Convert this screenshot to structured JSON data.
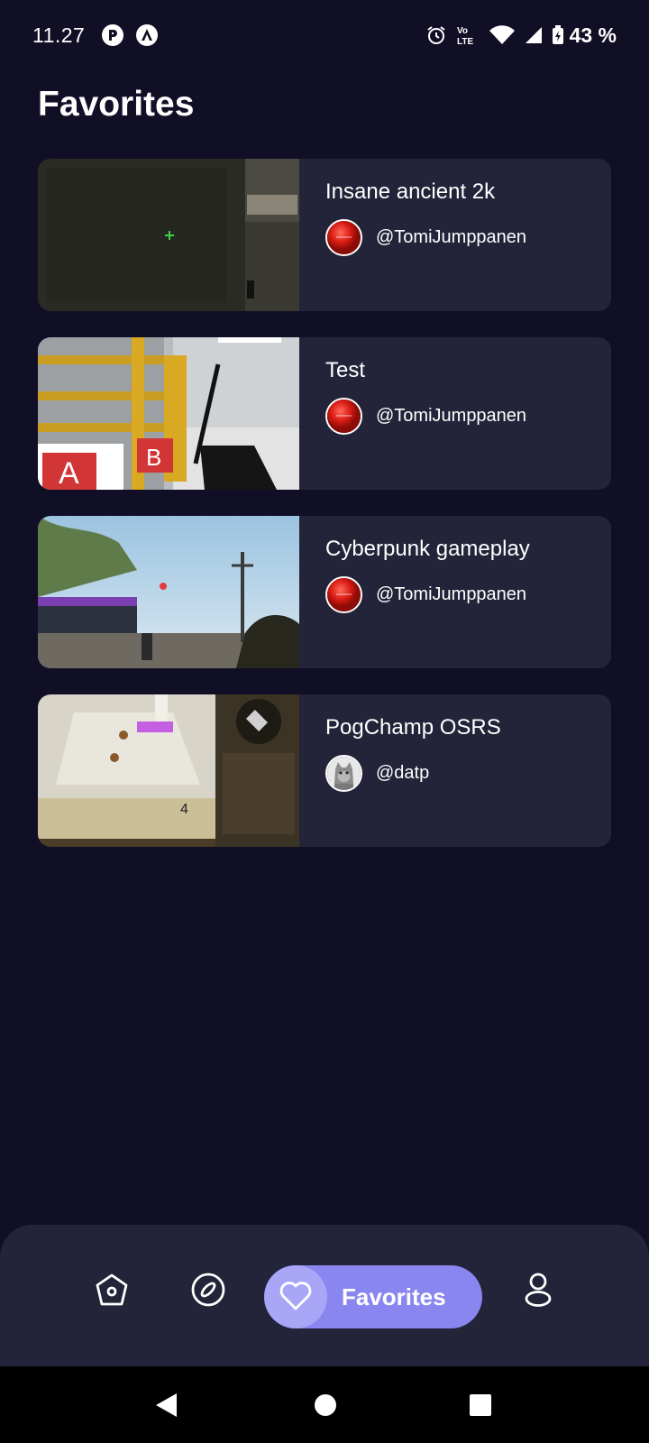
{
  "status_bar": {
    "time": "11.27",
    "battery": "43 %",
    "icons": [
      "app-icon-r",
      "app-icon-a",
      "alarm-icon",
      "volte-icon",
      "wifi-icon",
      "signal-icon",
      "battery-icon"
    ]
  },
  "page": {
    "title": "Favorites"
  },
  "favorites": [
    {
      "title": "Insane ancient 2k",
      "username": "@TomiJumppanen",
      "thumbnail": "dark-stone-wall-game-scene",
      "avatar": "red-ball-avatar"
    },
    {
      "title": "Test",
      "username": "@TomiJumppanen",
      "thumbnail": "yellow-railing-knife-game-scene",
      "avatar": "red-ball-avatar"
    },
    {
      "title": "Cyberpunk gameplay",
      "username": "@TomiJumppanen",
      "thumbnail": "sunny-beach-city-game-scene",
      "avatar": "red-ball-avatar"
    },
    {
      "title": "PogChamp OSRS",
      "username": "@datp",
      "thumbnail": "osrs-game-scene",
      "avatar": "grey-cat-avatar"
    }
  ],
  "bottom_nav": {
    "items": [
      "home-icon",
      "explore-icon",
      "heart-icon",
      "profile-icon"
    ],
    "active_label": "Favorites",
    "active_color": "#8a86f0"
  },
  "colors": {
    "background": "#110f26",
    "card": "#232339",
    "accent": "#8a86f0"
  }
}
